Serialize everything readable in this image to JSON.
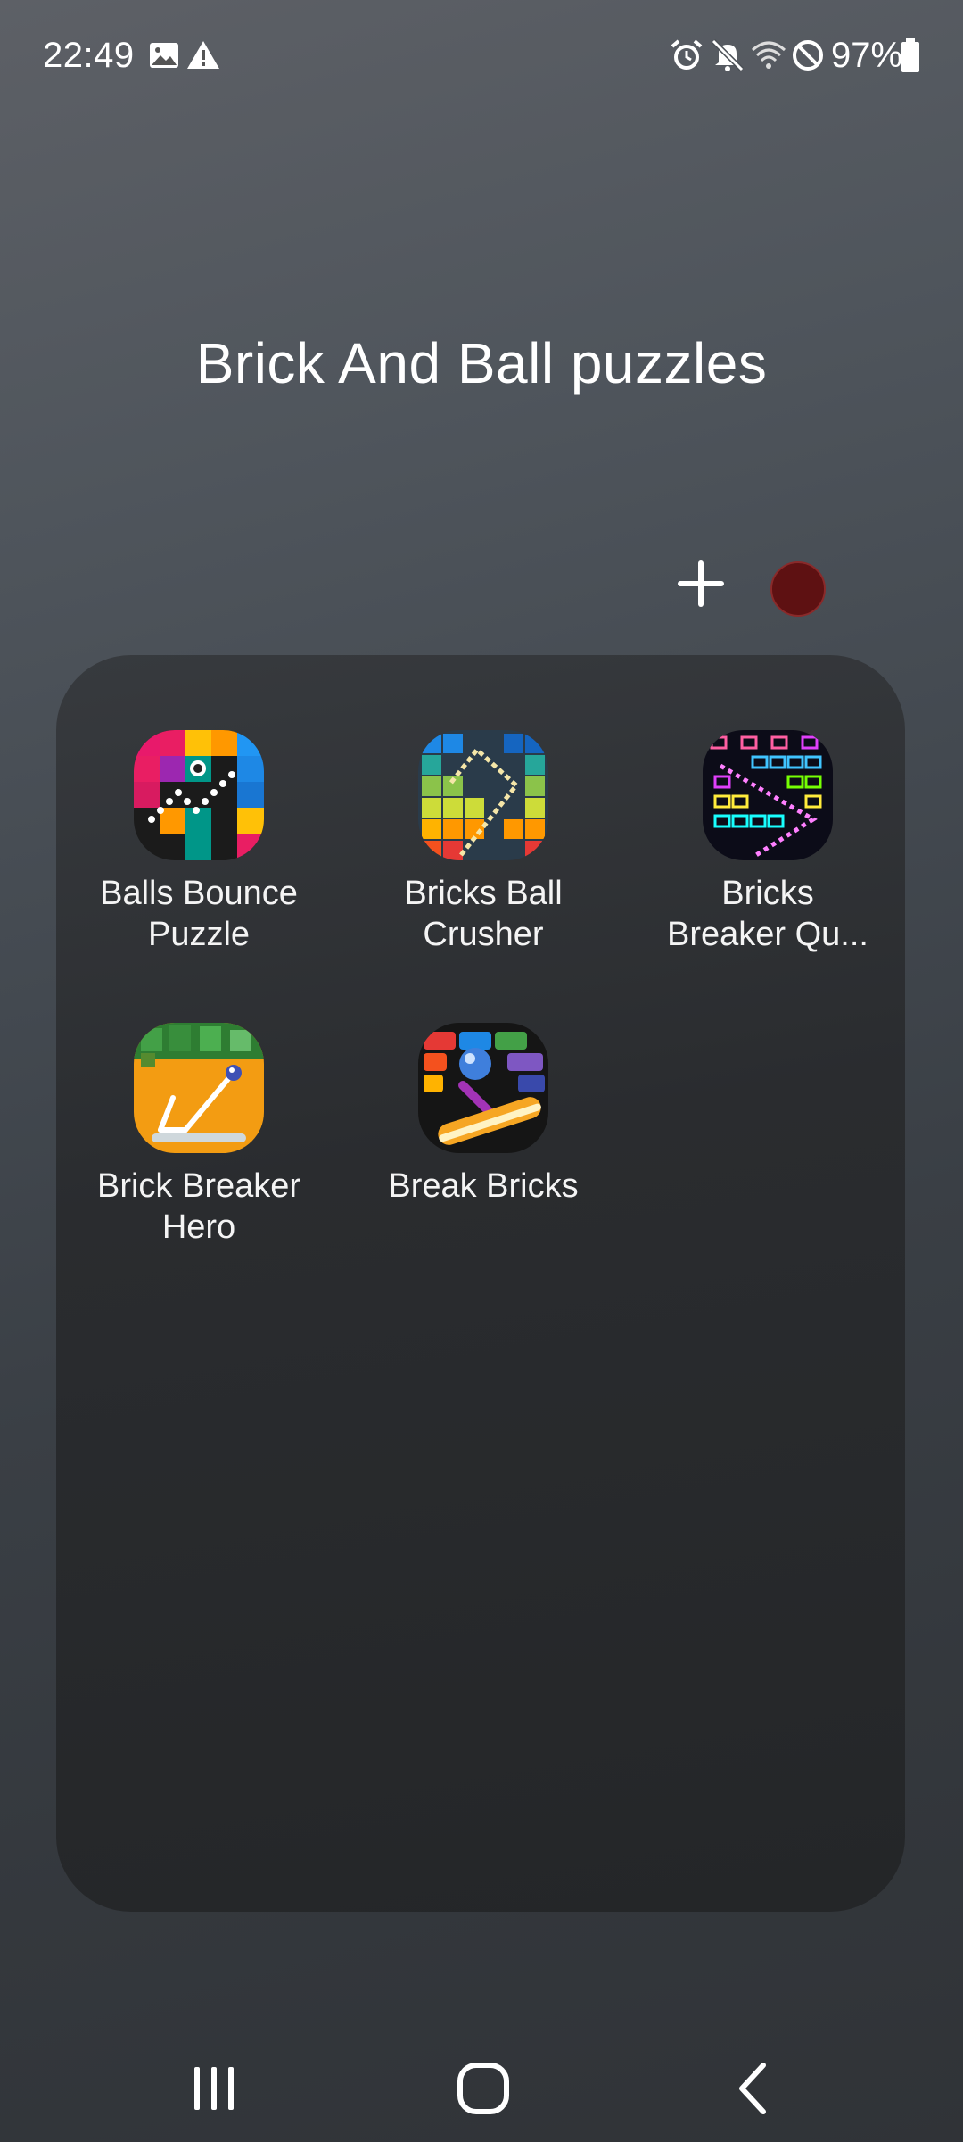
{
  "status_bar": {
    "time": "22:49",
    "left_icons": [
      "image-icon",
      "warning-icon"
    ],
    "right_icons": [
      "alarm-icon",
      "mute-icon",
      "wifi-icon",
      "do-not-disturb-icon",
      "battery-icon"
    ],
    "battery": "97%"
  },
  "folder": {
    "title": "Brick And Ball puzzles",
    "color": "#5e1112",
    "apps": [
      {
        "line1": "Balls Bounce",
        "line2": "Puzzle",
        "icon": "balls-bounce-puzzle-icon"
      },
      {
        "line1": "Bricks Ball",
        "line2": "Crusher",
        "icon": "bricks-ball-crusher-icon"
      },
      {
        "line1": "Bricks",
        "line2": "Breaker Qu...",
        "icon": "bricks-breaker-quest-icon"
      },
      {
        "line1": "Brick Breaker",
        "line2": "Hero",
        "icon": "brick-breaker-hero-icon"
      },
      {
        "line1": "Break Bricks",
        "line2": "",
        "icon": "break-bricks-icon"
      }
    ]
  },
  "nav_bar": {
    "buttons": [
      "recents-icon",
      "home-icon",
      "back-icon"
    ]
  }
}
